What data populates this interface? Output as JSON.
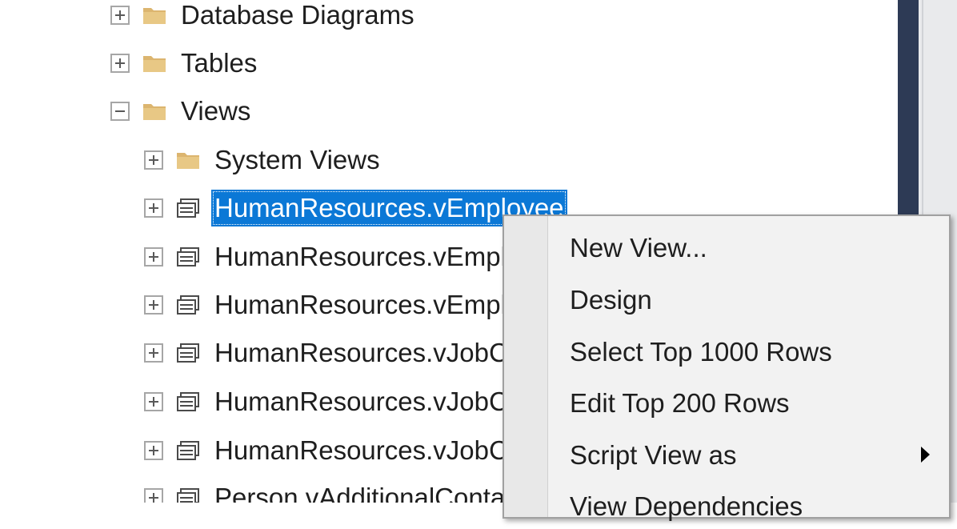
{
  "object_explorer": {
    "nodes": [
      {
        "label": "Database Diagrams",
        "expander": "plus",
        "icon": "folder-icon"
      },
      {
        "label": "Tables",
        "expander": "plus",
        "icon": "folder-icon"
      },
      {
        "label": "Views",
        "expander": "minus",
        "icon": "folder-icon"
      },
      {
        "label": "System Views",
        "expander": "plus",
        "icon": "folder-icon"
      },
      {
        "label": "HumanResources.vEmployee",
        "expander": "plus",
        "icon": "view-icon",
        "selected": true
      },
      {
        "label": "HumanResources.vEmployeeDepartment",
        "expander": "plus",
        "icon": "view-icon"
      },
      {
        "label": "HumanResources.vEmployeeDepartmentHistory",
        "expander": "plus",
        "icon": "view-icon"
      },
      {
        "label": "HumanResources.vJobCandidate",
        "expander": "plus",
        "icon": "view-icon"
      },
      {
        "label": "HumanResources.vJobCandidateEducation",
        "expander": "plus",
        "icon": "view-icon"
      },
      {
        "label": "HumanResources.vJobCandidateEmployment",
        "expander": "plus",
        "icon": "view-icon"
      },
      {
        "label": "Person.vAdditionalContactInfo",
        "expander": "plus",
        "icon": "view-icon"
      }
    ]
  },
  "context_menu": {
    "items": [
      {
        "label": "New View...",
        "has_submenu": false
      },
      {
        "label": "Design",
        "has_submenu": false
      },
      {
        "label": "Select Top 1000 Rows",
        "has_submenu": false
      },
      {
        "label": "Edit Top 200 Rows",
        "has_submenu": false
      },
      {
        "label": "Script View as",
        "has_submenu": true
      },
      {
        "label": "View Dependencies",
        "has_submenu": false
      }
    ]
  },
  "colors": {
    "selection": "#0b78d6",
    "folder": "#dcb56f",
    "scrollbar_dark": "#2d3a55",
    "menu_background": "#f2f2f2"
  }
}
